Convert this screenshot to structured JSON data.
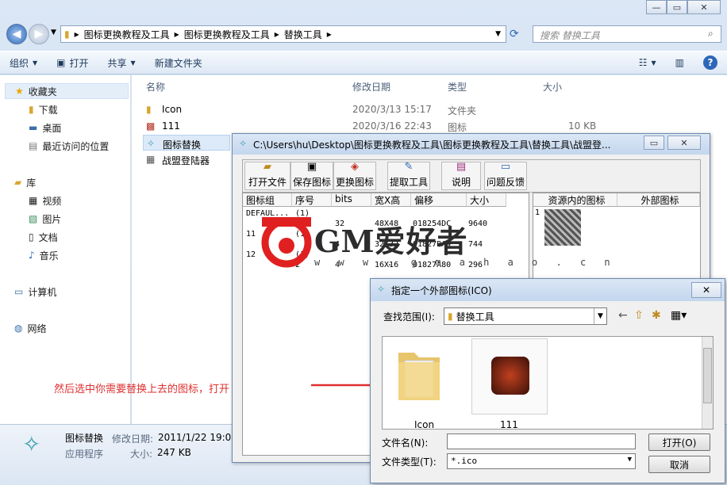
{
  "explorer": {
    "breadcrumbs": [
      "图标更换教程及工具",
      "图标更换教程及工具",
      "替换工具"
    ],
    "search_placeholder": "搜索 替换工具",
    "toolbar": {
      "organize": "组织",
      "open": "打开",
      "share": "共享",
      "new_folder": "新建文件夹"
    },
    "nav": {
      "favorites": "收藏夹",
      "downloads": "下载",
      "desktop": "桌面",
      "recent": "最近访问的位置",
      "libraries": "库",
      "videos": "视频",
      "pictures": "图片",
      "documents": "文档",
      "music": "音乐",
      "computer": "计算机",
      "network": "网络"
    },
    "columns": {
      "name": "名称",
      "modified": "修改日期",
      "type": "类型",
      "size": "大小"
    },
    "files": [
      {
        "name": "Icon",
        "modified": "2020/3/13 15:17",
        "type": "文件夹",
        "size": ""
      },
      {
        "name": "111",
        "modified": "2020/3/16 22:43",
        "type": "图标",
        "size": "10 KB"
      },
      {
        "name": "图标替换",
        "modified": "",
        "type": "",
        "size": ""
      },
      {
        "name": "战盟登陆器",
        "modified": "",
        "type": "",
        "size": ""
      }
    ],
    "details": {
      "name": "图标替换",
      "modified_label": "修改日期:",
      "modified": "2011/1/22 19:06",
      "type": "应用程序",
      "size_label": "大小:",
      "size": "247 KB"
    }
  },
  "annotation": {
    "text": "然后选中你需要替换上去的图标，打开",
    "color": "#e03030"
  },
  "watermark": {
    "brand": "GM爱好者",
    "url": "w w w . g m a h a o . c n"
  },
  "iconwin": {
    "title": "C:\\Users\\hu\\Desktop\\图标更换教程及工具\\图标更换教程及工具\\替换工具\\战盟登...",
    "buttons": {
      "open": "打开文件",
      "save": "保存图标",
      "replace": "更换图标",
      "extract": "提取工具",
      "help": "说明",
      "feedback": "问题反馈"
    },
    "list_headers": [
      "图标组",
      "序号",
      "bits",
      "宽X高",
      "偏移",
      "大小"
    ],
    "rows": [
      [
        "DEFAUL...",
        "(1)",
        "",
        "",
        "",
        ""
      ],
      [
        "",
        "",
        "32",
        "48X48",
        "018254DC",
        "9640"
      ],
      [
        "11",
        "(1)",
        "",
        "",
        "",
        ""
      ],
      [
        "",
        "",
        "4",
        "32X32",
        "01827BA4",
        "744"
      ],
      [
        "12",
        "(1)",
        "",
        "",
        "",
        ""
      ],
      [
        "",
        "2",
        "4",
        "16X16",
        "01827A80",
        "296"
      ]
    ],
    "res_headers": [
      "资源内的图标",
      "外部图标"
    ],
    "res_index": "1"
  },
  "dialog": {
    "title": "指定一个外部图标(ICO)",
    "lookin_label": "查找范围(I):",
    "lookin_value": "替换工具",
    "items": [
      "Icon",
      "111"
    ],
    "filename_label": "文件名(N):",
    "filename_value": "",
    "filetype_label": "文件类型(T):",
    "filetype_value": "*.ico",
    "open_button": "打开(O)",
    "cancel_button": "取消"
  }
}
